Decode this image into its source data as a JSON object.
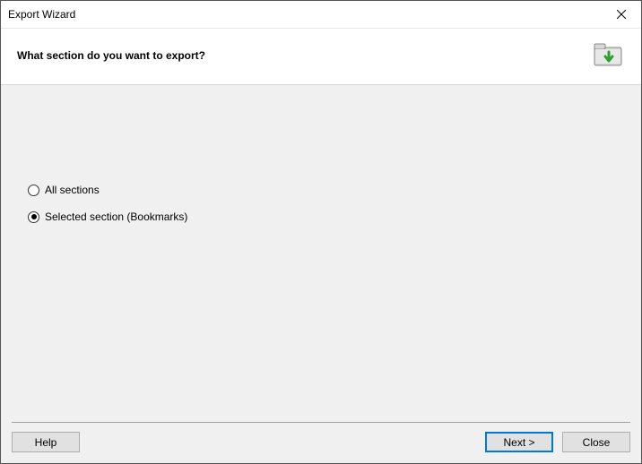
{
  "window_title": "Export Wizard",
  "header": {
    "heading": "What section do you want to export?"
  },
  "options": {
    "all_sections": {
      "label": "All sections",
      "selected": false
    },
    "selected_section": {
      "label": "Selected section (Bookmarks)",
      "selected": true
    }
  },
  "footer": {
    "help": "Help",
    "next": "Next >",
    "close": "Close"
  },
  "icons": {
    "close": "close-icon",
    "export_folder": "export-folder-icon"
  }
}
